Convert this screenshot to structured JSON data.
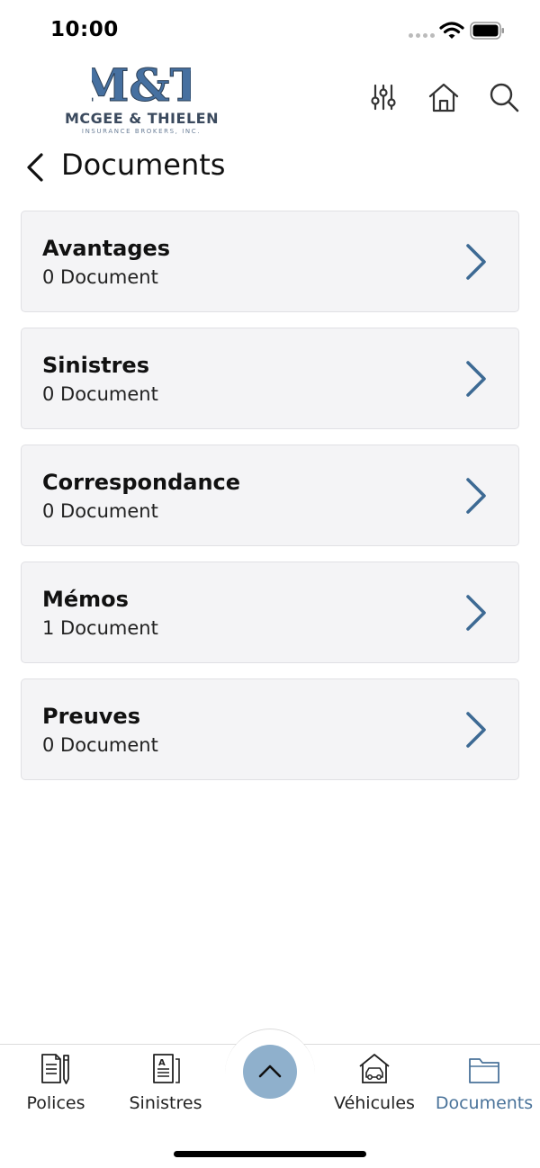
{
  "status": {
    "time": "10:00"
  },
  "header": {
    "logo_mark": "M&T",
    "logo_name": "MCGEE & THIELEN",
    "logo_sub": "INSURANCE BROKERS, INC.",
    "icons": [
      "sliders-icon",
      "home-icon",
      "search-icon"
    ]
  },
  "page": {
    "title": "Documents"
  },
  "cards": [
    {
      "title": "Avantages",
      "count": "0 Document"
    },
    {
      "title": "Sinistres",
      "count": "0 Document"
    },
    {
      "title": "Correspondance",
      "count": "0 Document"
    },
    {
      "title": "Mémos",
      "count": "1 Document"
    },
    {
      "title": "Preuves",
      "count": "0 Document"
    }
  ],
  "nav": {
    "items": [
      {
        "label": "Polices",
        "icon": "policy-document-icon"
      },
      {
        "label": "Sinistres",
        "icon": "claims-document-icon"
      },
      {
        "label": "Véhicules",
        "icon": "vehicle-garage-icon"
      },
      {
        "label": "Documents",
        "icon": "folder-icon"
      }
    ],
    "active": "Documents"
  },
  "colors": {
    "accent": "#3d6a94",
    "active_nav": "#4a739a",
    "fab": "#8fb0cc",
    "card_bg": "#f4f4f6",
    "logo_blue": "#4670a0"
  }
}
